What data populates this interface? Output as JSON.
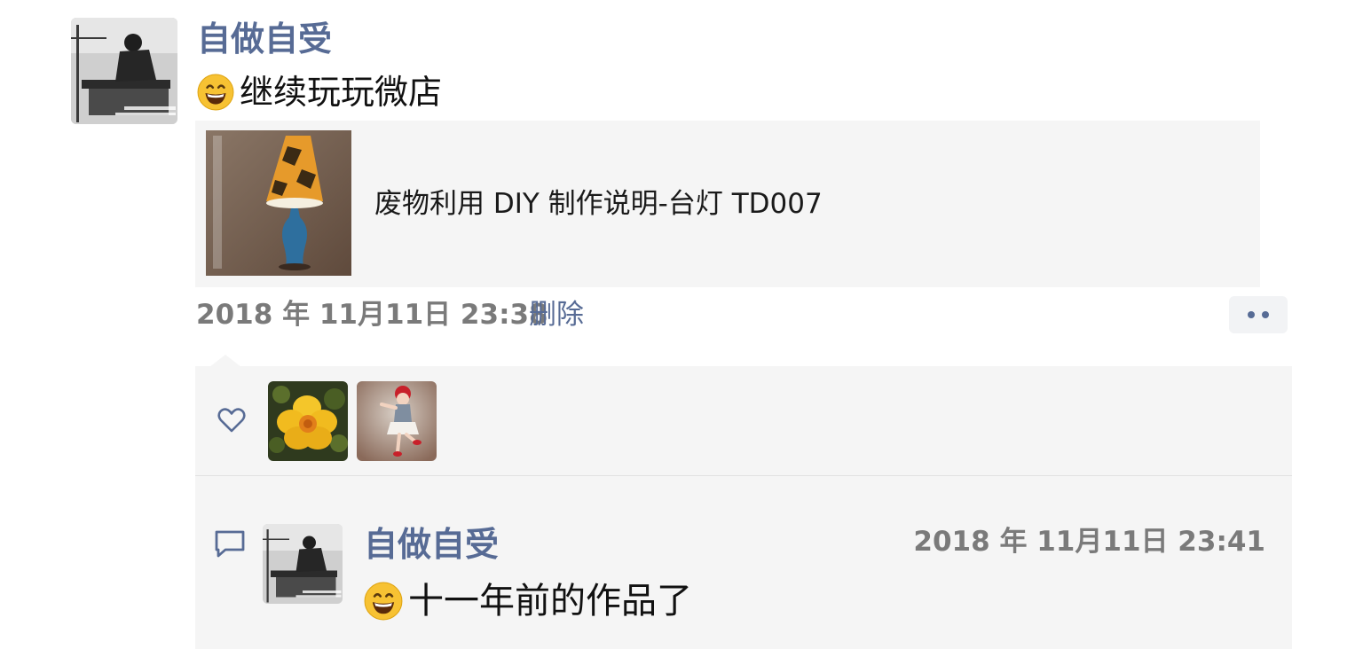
{
  "post": {
    "author": "自做自受",
    "emoji_icon": "grinning-face-emoji",
    "text": "继续玩玩微店",
    "link": {
      "title": "废物利用 DIY 制作说明-台灯 TD007",
      "thumbnail_icon": "lamp-photo",
      "thumbnail_overlay_text": "废物利用DIY制作说明-台灯"
    },
    "time": "2018 年 11月11日 23:38",
    "delete_label": "删除",
    "more_icon": "more-dots-icon"
  },
  "likes": {
    "icon": "heart-icon",
    "users": [
      {
        "avatar": "yellow-flower-avatar"
      },
      {
        "avatar": "dancing-girl-avatar"
      }
    ]
  },
  "comment": {
    "icon": "comment-bubble-icon",
    "author": "自做自受",
    "time": "2018 年 11月11日 23:41",
    "emoji_icon": "grinning-face-emoji",
    "text": "十一年前的作品了"
  },
  "colors": {
    "link_blue": "#576b95",
    "panel_bg": "#f5f5f5",
    "meta_gray": "#7a7a7a"
  }
}
